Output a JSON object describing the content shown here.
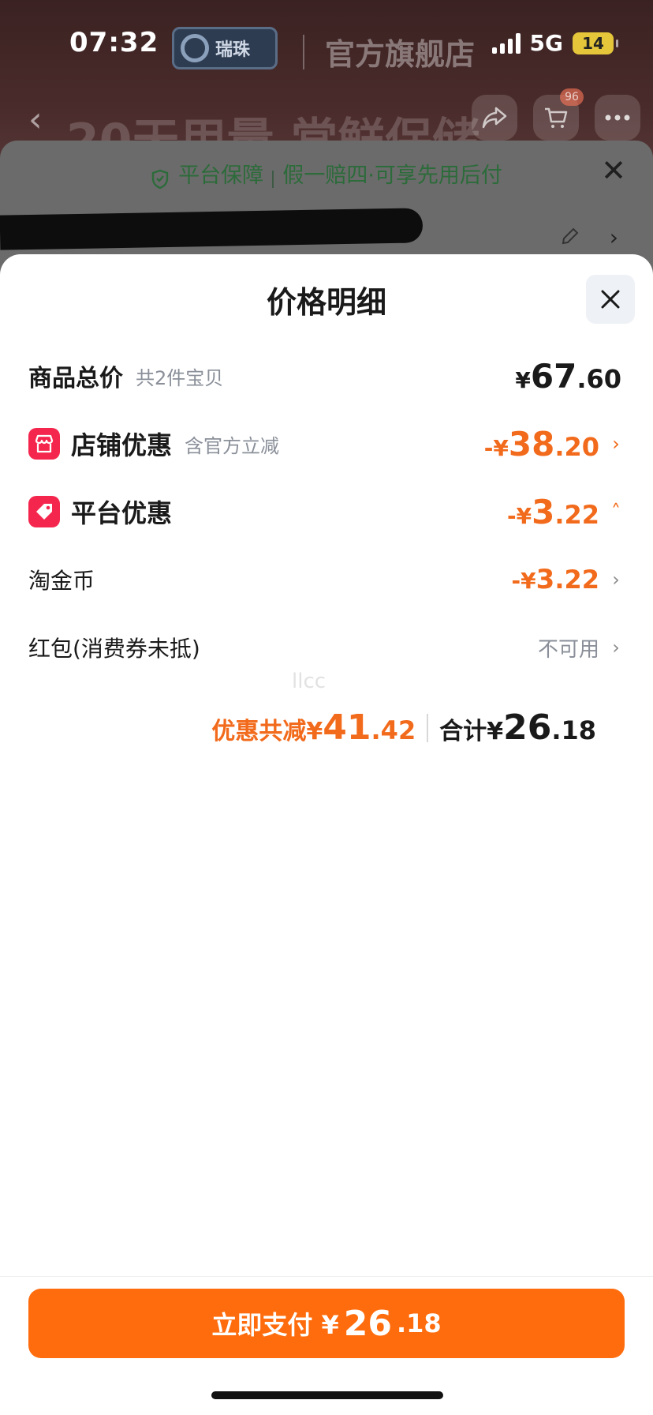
{
  "status": {
    "time": "07:32",
    "network": "5G",
    "battery": "14"
  },
  "background": {
    "store_logo_text": "瑞珠",
    "store_name": "官方旗舰店",
    "title": "20天用量 常鲜保储",
    "cart_badge": "96",
    "guarantee": {
      "prefix": "平台保障",
      "text": "假一赔四·可享先用后付"
    }
  },
  "sheet": {
    "title": "价格明细",
    "rows": {
      "total": {
        "label": "商品总价",
        "sub": "共2件宝贝",
        "sym": "¥",
        "int": "67",
        "dec": ".60"
      },
      "store_discount": {
        "label": "店铺优惠",
        "sub": "含官方立减",
        "sym": "-¥",
        "int": "38",
        "dec": ".20"
      },
      "platform_discount": {
        "label": "平台优惠",
        "sym": "-¥",
        "int": "3",
        "dec": ".22"
      },
      "coins": {
        "label": "淘金币",
        "sym": "-¥",
        "int": "3",
        "dec": ".22"
      },
      "red_packet": {
        "label": "红包(消费券未抵)",
        "status": "不可用"
      }
    },
    "watermark": "llcc",
    "summary": {
      "off_label": "优惠共减¥",
      "off_int": "41",
      "off_dec": ".42",
      "total_label": "合计¥",
      "total_int": "26",
      "total_dec": ".18"
    }
  },
  "pay_button": {
    "label": "立即支付 ¥",
    "int": "26",
    "dec": ".18"
  },
  "colors": {
    "accent": "#ff6c0d",
    "discount": "#f26a1b",
    "store_icon": "#f5264d"
  },
  "icons": [
    "back-icon",
    "share-icon",
    "cart-icon",
    "more-icon",
    "shield-icon",
    "close-icon",
    "edit-icon",
    "store-icon",
    "coupon-tag-icon",
    "chevron-right-icon",
    "chevron-up-icon"
  ]
}
